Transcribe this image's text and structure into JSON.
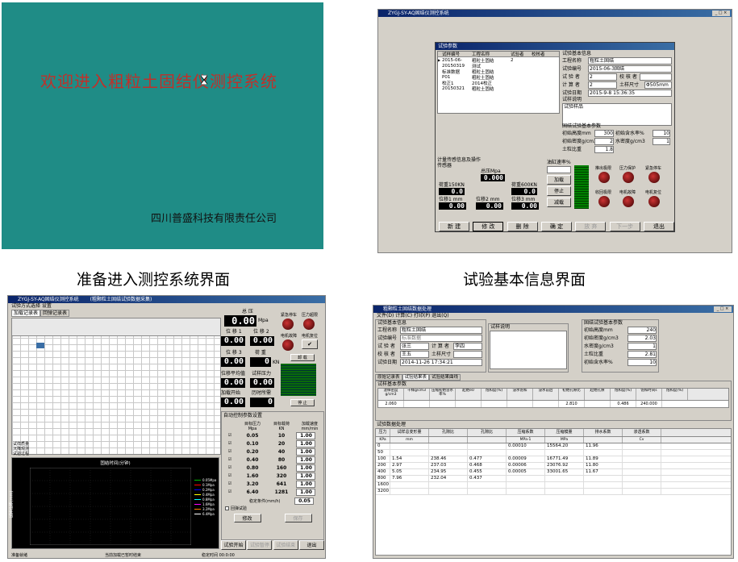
{
  "captions": {
    "p1": "准备进入测控系统界面",
    "p2": "试验基本信息界面"
  },
  "splash": {
    "title": "欢迎进入粗粒土固结仪测控系统",
    "company": "四川普盛科技有限责任公司",
    "bg": "#1f8c86",
    "title_color": "#c0302a"
  },
  "info": {
    "title": "ZYGJ-SY-AQ固结仪测控系统",
    "dialog_title": "试验参数",
    "list_headers": [
      "试样编号",
      "工程名称",
      "试验者",
      "校核者"
    ],
    "list_rows": [
      [
        "2015-06-",
        "粗粒土固结",
        "2",
        ""
      ],
      [
        "20150319",
        "测试",
        "",
        ""
      ],
      [
        "标准数据",
        "粗粒土固结",
        "",
        ""
      ],
      [
        "P01",
        "粗粒土固结",
        "",
        ""
      ],
      [
        "校正1",
        "2014校正",
        "",
        ""
      ],
      [
        "20150321",
        "粗粒土固结",
        "",
        ""
      ]
    ],
    "basic_title": "试验基本信息",
    "project_label": "工程名称",
    "project": "粗粒土固结",
    "sample_label": "试验编号",
    "sample": "2015-06-3固结",
    "tester_label": "试 验 者",
    "tester": "2",
    "checker_label": "校 核 者",
    "calc_label": "计 算 者",
    "calc": "2",
    "size_label": "土样尺寸",
    "size": "Φ505mm",
    "date_label": "试验日期",
    "date": "2015-9-8 15:36:35",
    "desc_label": "试样说明",
    "sample_desc_label": "试验样品",
    "param_title": "固结试验基本参数",
    "height_label": "初始高度mm",
    "height": "300",
    "moist_label": "初始含水率%",
    "moist": "10",
    "density_label": "初始密度g/cm3",
    "density": "2",
    "wdensity_label": "水密度g/cm3",
    "wdensity": "1",
    "ratio_label": "土粒比重",
    "ratio": "1.8",
    "sensor_title": "计量传感信息及操作",
    "sensor_label": "传感器",
    "pressure_label": "总压Mpa",
    "pressure": "0.000",
    "load1_label": "荷重150KN",
    "load1": "0.0",
    "load2_label": "荷重600KN",
    "load2": "0.0",
    "disp1_label": "位移1 mm",
    "disp1": "0.00",
    "disp2_label": "位移2 mm",
    "disp2": "0.00",
    "disp3_label": "位移3 mm",
    "disp3": "0.00",
    "rate_label": "油缸速率%",
    "ctrl_add": "加载",
    "ctrl_stop": "停止",
    "ctrl_sub": "减载",
    "knob_labels": [
      "推出极限",
      "压力保护",
      "紧急停车",
      "收回极限",
      "电机故障",
      "电机复位"
    ],
    "buttons": [
      "新 建",
      "修 改",
      "删 除",
      "确 定",
      "放 弃",
      "下一步",
      "退出"
    ]
  },
  "load": {
    "title": "ZYGJ-SY-AQ固结仪测控系统",
    "title2": "(粗颗粒土固结试验数据采集)",
    "menu": "试验方式选择  设置",
    "tabs": [
      "加载记录表",
      "回弹记录表"
    ],
    "total_label": "总 压",
    "total_unit": "Mpa",
    "total": "0.00",
    "disp1_label": "位 移 1",
    "disp1": "0.00",
    "disp2_label": "位 移 2",
    "disp2": "0.00",
    "disp3_label": "位 移 3",
    "disp3": "0.00",
    "load_label": "荷 重",
    "load": "0",
    "load_unit": "KN",
    "avg_label": "位移平均值",
    "avg": "0.00",
    "pres_label": "试样压力",
    "pres": "0.00",
    "start_label": "加载开始",
    "start": "0.00",
    "elapsed_label": "历时所需",
    "elapsed": "0",
    "emergency": "紧急停车",
    "overload": "压力超限",
    "motor_fault": "电机故障",
    "motor_reset": "电机复位",
    "unload": "卸 载",
    "stop": "停 止",
    "auto_title": "自动控制参数设置",
    "col_pressure": "目标压力",
    "col_pressure_unit": "Mpa",
    "col_load": "目标载荷",
    "col_load_unit": "KN",
    "col_speed": "加载速度",
    "col_speed_unit": "mm/min",
    "steps": [
      [
        "0.05",
        "10",
        "1.00"
      ],
      [
        "0.10",
        "20",
        "1.00"
      ],
      [
        "0.20",
        "40",
        "1.00"
      ],
      [
        "0.40",
        "80",
        "1.00"
      ],
      [
        "0.80",
        "160",
        "1.00"
      ],
      [
        "1.60",
        "320",
        "1.00"
      ],
      [
        "3.20",
        "641",
        "1.00"
      ],
      [
        "6.40",
        "1281",
        "1.00"
      ]
    ],
    "stable_label": "稳定条件(mm/h)",
    "stable": "0.05",
    "rebound": "回弹试验",
    "modify": "修改",
    "save": "保存",
    "start_btn": "试验开始",
    "btn_a": "试验暂停",
    "btn_b": "试验结束",
    "exit": "退出",
    "chart_title": "固结时间(分钟)",
    "chart_ylabel": "试样位移(mm)",
    "legend": [
      "0.05Mpa",
      "0.1Mpa",
      "0.2Mpa",
      "0.4Mpa",
      "0.8Mpa",
      "1.6Mpa",
      "3.2Mpa",
      "6.4Mpa"
    ],
    "legend_colors": [
      "#00c000",
      "#ff0000",
      "#0000ff",
      "#ffff00",
      "#00ffff",
      "#ff00ff",
      "#ff8000",
      "#ffffff"
    ],
    "left_label1": "试样质量",
    "left_label2": "沉降观测",
    "left_label3": "试验过程",
    "status1": "准备就绪",
    "status2": "当前加载已暂时结束",
    "status3": "稳定时间 00:0:00"
  },
  "data": {
    "title": "粗颗粒土固结数据处理",
    "menu": "文件(D)  计算(C)  打印(P)  退出(Q)",
    "basic_title": "试验基本信息",
    "project_label": "工程名称",
    "project": "粗粒土固结",
    "sample_label": "试验编号",
    "sample": "标准数据",
    "tester_label": "试 验 者",
    "tester": "张三",
    "calc_label": "计 算 者",
    "calc": "李四",
    "checker_label": "校 核 者",
    "checker": "王五",
    "size_label": "土样尺寸",
    "date_label": "试验日期",
    "date": "2014-11-26 17:34:21",
    "desc_label": "试样说明",
    "param_title": "固结试验基本参数",
    "params": [
      [
        "初始高度mm",
        "240"
      ],
      [
        "初始密度g/cm3",
        "2.03"
      ],
      [
        "水密度g/cm3",
        "1"
      ],
      [
        "土粒比重",
        "2.81"
      ],
      [
        "初始含水率%",
        "10"
      ]
    ],
    "tabs": [
      "原始记录表",
      "试验结果表",
      "试验结果曲线"
    ],
    "res_title": "试样基本参数",
    "res_headers": [
      "湿样密度g/cm3",
      "干样g/cm3",
      "压缩初始含水率%",
      "起始e0",
      "饱和度(%)",
      "浸水饱和",
      "浸水前后",
      "初始孔隙比",
      "起始孔隙",
      "饱和度(%)",
      "饱和时间s",
      "饱和度(%)"
    ],
    "res_values": [
      "2.060",
      "",
      "",
      "",
      "",
      "",
      "",
      "2.810",
      "",
      "0.486",
      "240.000"
    ],
    "proc_title": "试验数据处理",
    "proc_headers": [
      "压力",
      "试样总变形量",
      "孔隙比",
      "孔隙比",
      "压缩系数",
      "压缩模量",
      "排水系数",
      "渗透系数"
    ],
    "proc_units": [
      "KPa",
      "mm",
      "",
      "",
      "MPa-1",
      "MPa",
      "",
      "Cv"
    ],
    "proc_rows": [
      [
        "0",
        "",
        "",
        "",
        "0.00010",
        "15564.20",
        "11.96",
        ""
      ],
      [
        "50",
        "",
        "",
        "",
        "",
        "",
        "",
        ""
      ],
      [
        "100",
        "1.54",
        "238.46",
        "0.477",
        "0.00009",
        "16771.49",
        "11.89",
        ""
      ],
      [
        "200",
        "2.97",
        "237.03",
        "0.468",
        "0.00006",
        "23076.92",
        "11.80",
        ""
      ],
      [
        "400",
        "5.05",
        "234.95",
        "0.455",
        "0.00005",
        "33001.65",
        "11.67",
        ""
      ],
      [
        "800",
        "7.96",
        "232.04",
        "0.437",
        "",
        "",
        "",
        ""
      ],
      [
        "1600",
        "",
        "",
        "",
        "",
        "",
        "",
        ""
      ],
      [
        "3200",
        "",
        "",
        "",
        "",
        "",
        "",
        ""
      ]
    ]
  }
}
